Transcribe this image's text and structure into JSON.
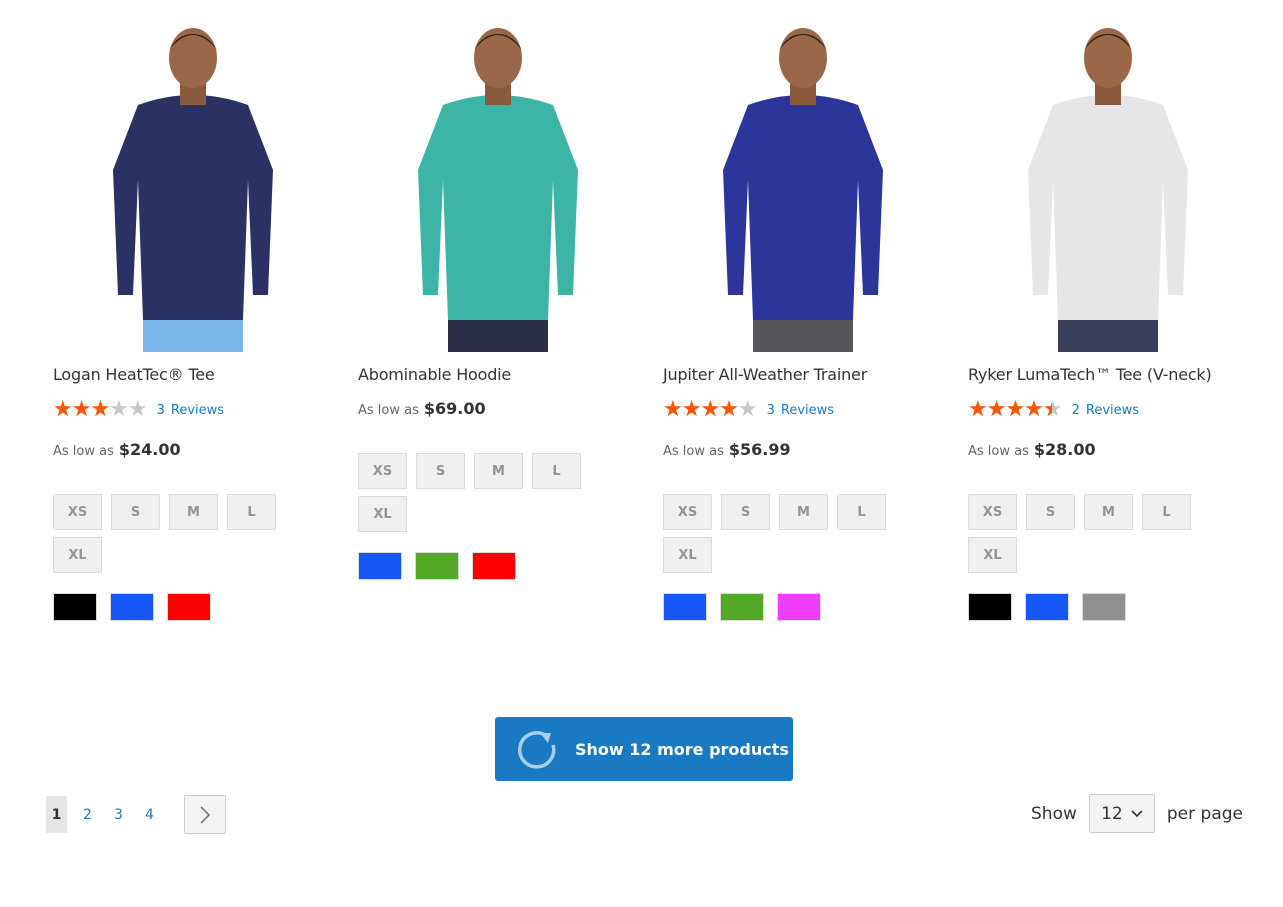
{
  "products": [
    {
      "name": "Logan HeatTec® Tee",
      "rating_percent": 60,
      "reviews_count": "3",
      "reviews_label": "Reviews",
      "price_label": "As low as",
      "price": "$24.00",
      "sizes": [
        "XS",
        "S",
        "M",
        "L",
        "XL"
      ],
      "swatches": [
        "#000000",
        "#1857f7",
        "#ff0000"
      ],
      "shirt_color": "#2a3263",
      "pants_color": "#7ab6ea"
    },
    {
      "name": "Abominable Hoodie",
      "price_label": "As low as",
      "price": "$69.00",
      "sizes": [
        "XS",
        "S",
        "M",
        "L",
        "XL"
      ],
      "swatches": [
        "#1857f7",
        "#53a828",
        "#ff0000"
      ],
      "shirt_color": "#3db5a6",
      "pants_color": "#2b2f45"
    },
    {
      "name": "Jupiter All-Weather Trainer",
      "rating_percent": 80,
      "reviews_count": "3",
      "reviews_label": "Reviews",
      "price_label": "As low as",
      "price": "$56.99",
      "sizes": [
        "XS",
        "S",
        "M",
        "L",
        "XL"
      ],
      "swatches": [
        "#1857f7",
        "#53a828",
        "#ef3dff"
      ],
      "shirt_color": "#2c369a",
      "pants_color": "#55555a"
    },
    {
      "name": "Ryker LumaTech™ Tee (V-neck)",
      "rating_percent": 90,
      "reviews_count": "2",
      "reviews_label": "Reviews",
      "price_label": "As low as",
      "price": "$28.00",
      "sizes": [
        "XS",
        "S",
        "M",
        "L",
        "XL"
      ],
      "swatches": [
        "#000000",
        "#1857f7",
        "#8f8f8f"
      ],
      "shirt_color": "#e6e6e8",
      "pants_color": "#39415a"
    }
  ],
  "load_more": {
    "label": "Show 12 more products",
    "icon": "refresh-icon"
  },
  "pagination": {
    "pages": [
      "1",
      "2",
      "3",
      "4"
    ],
    "current": "1"
  },
  "limiter": {
    "show_label": "Show",
    "value": "12",
    "per_page_label": "per page"
  },
  "colors": {
    "accent": "#1979c3",
    "star": "#ff5501"
  }
}
